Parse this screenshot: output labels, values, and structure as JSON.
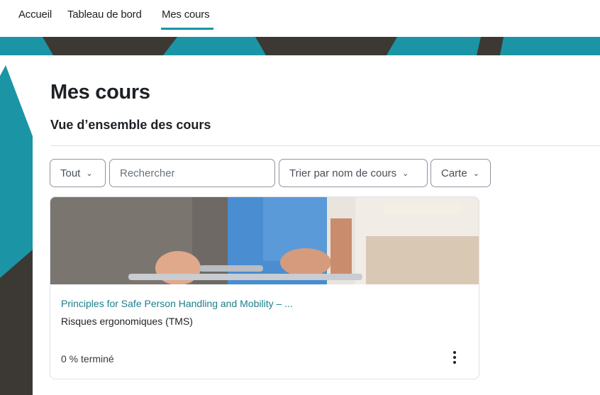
{
  "nav": {
    "items": [
      {
        "label": "Accueil"
      },
      {
        "label": "Tableau de bord"
      },
      {
        "label": "Mes cours"
      }
    ],
    "active_index": 2
  },
  "page": {
    "title": "Mes cours",
    "section_title": "Vue d’ensemble des cours"
  },
  "filters": {
    "grouping_label": "Tout",
    "search_placeholder": "Rechercher",
    "sort_label": "Trier par nom de cours",
    "view_label": "Carte"
  },
  "courses": [
    {
      "name": "Principles for Safe Person Handling and Mobility – ...",
      "category": "Risques ergonomiques (TMS)",
      "progress_text": "0 % terminé",
      "progress_percent": 0
    }
  ],
  "colors": {
    "accent": "#1b95a5",
    "dark": "#3c3935",
    "link": "#1b7f8c"
  },
  "icons": {
    "dropdown": "chevron-down-icon",
    "course_menu": "kebab-menu-icon"
  }
}
